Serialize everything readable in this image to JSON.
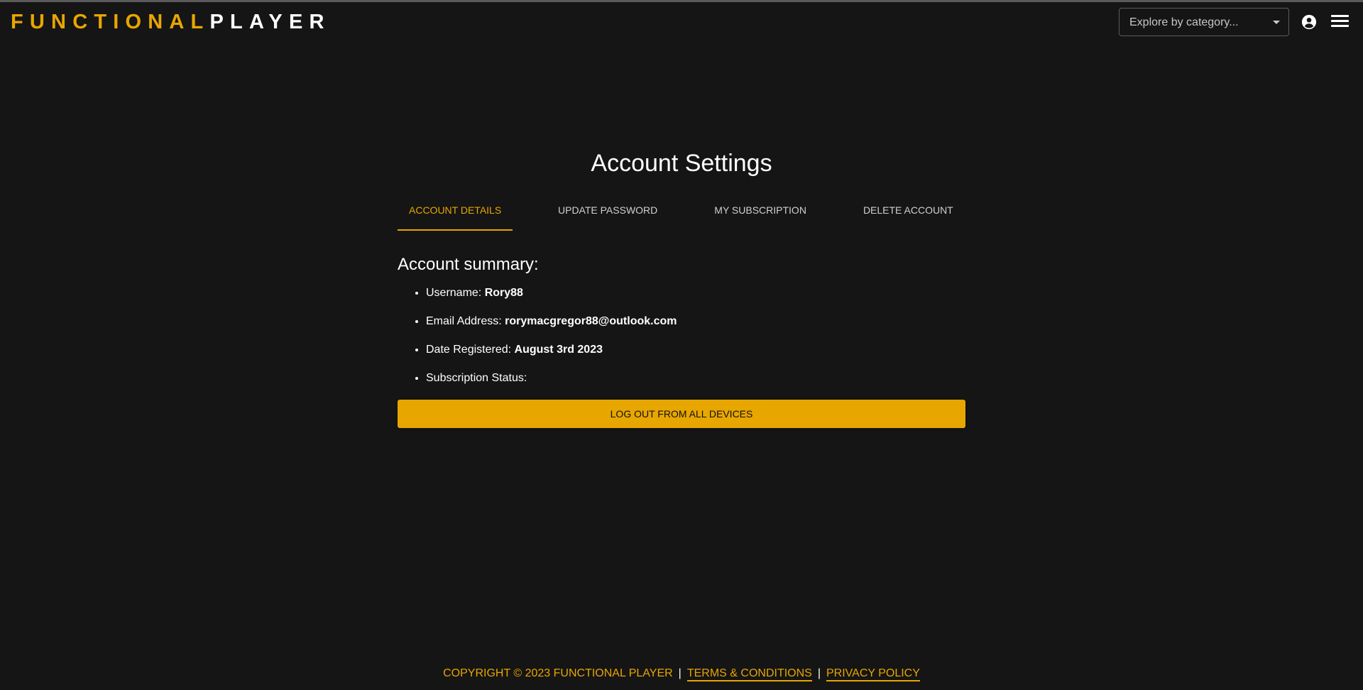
{
  "header": {
    "logo_part1": "FUNCTIONAL",
    "logo_part2": "PLAYER",
    "category_placeholder": "Explore by category...",
    "account_icon": "account-circle-icon",
    "menu_icon": "hamburger-menu-icon"
  },
  "main": {
    "title": "Account Settings",
    "tabs": [
      {
        "label": "ACCOUNT DETAILS",
        "active": true
      },
      {
        "label": "UPDATE PASSWORD",
        "active": false
      },
      {
        "label": "MY SUBSCRIPTION",
        "active": false
      },
      {
        "label": "DELETE ACCOUNT",
        "active": false
      }
    ],
    "summary_title": "Account summary:",
    "summary": [
      {
        "label": "Username: ",
        "value": "Rory88"
      },
      {
        "label": "Email Address: ",
        "value": "rorymacgregor88@outlook.com"
      },
      {
        "label": "Date Registered: ",
        "value": "August 3rd 2023"
      },
      {
        "label": "Subscription Status: ",
        "value": ""
      }
    ],
    "logout_button": "LOG OUT FROM ALL DEVICES"
  },
  "footer": {
    "copyright": "COPYRIGHT © 2023 FUNCTIONAL PLAYER",
    "separator": "|",
    "terms": "TERMS & CONDITIONS",
    "privacy": "PRIVACY POLICY"
  },
  "colors": {
    "background": "#151515",
    "accent": "#e8a600",
    "text": "#ffffff"
  }
}
